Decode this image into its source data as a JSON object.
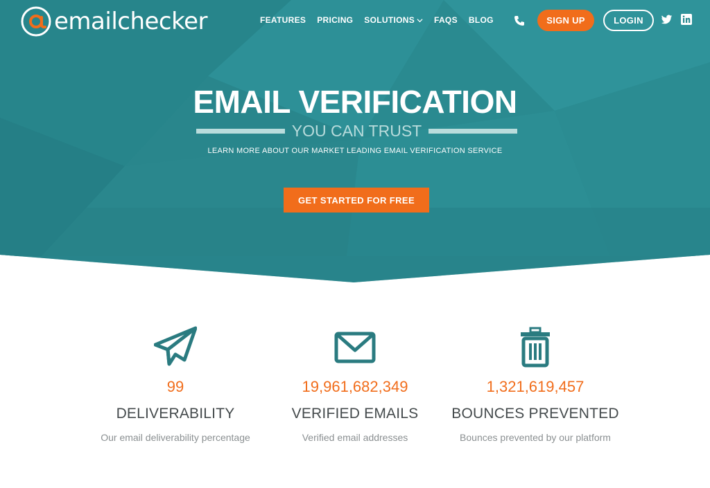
{
  "brand": {
    "name": "emailchecker"
  },
  "nav": {
    "items": [
      {
        "label": "FEATURES"
      },
      {
        "label": "PRICING"
      },
      {
        "label": "SOLUTIONS"
      },
      {
        "label": "FAQS"
      },
      {
        "label": "BLOG"
      }
    ],
    "signup_label": "SIGN UP",
    "login_label": "LOGIN"
  },
  "hero": {
    "headline": "EMAIL VERIFICATION",
    "subheadline": "YOU CAN TRUST",
    "tagline": "LEARN MORE ABOUT OUR MARKET LEADING EMAIL VERIFICATION SERVICE",
    "cta_label": "GET STARTED FOR FREE"
  },
  "stats": [
    {
      "icon": "paper-plane-icon",
      "value": "99",
      "title": "DELIVERABILITY",
      "desc": "Our email deliverability percentage"
    },
    {
      "icon": "envelope-icon",
      "value": "19,961,682,349",
      "title": "VERIFIED EMAILS",
      "desc": "Verified email addresses"
    },
    {
      "icon": "trash-icon",
      "value": "1,321,619,457",
      "title": "BOUNCES PREVENTED",
      "desc": "Bounces prevented by our platform"
    }
  ],
  "colors": {
    "hero_bg": "#2a8a90",
    "accent": "#f16d1b",
    "icon_teal": "#2a7b80",
    "title_text": "#444a4c",
    "muted_text": "#8a8f91"
  }
}
